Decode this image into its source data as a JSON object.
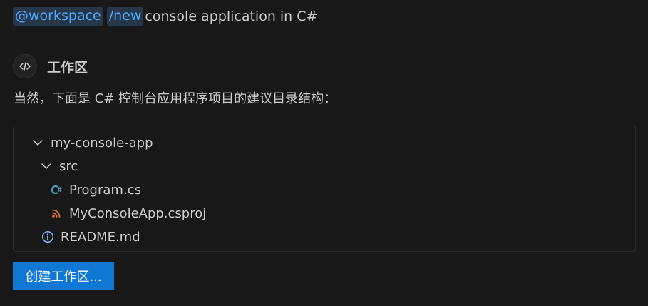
{
  "prompt": {
    "agent_mention": "@workspace",
    "command": "/new",
    "text": "console application in C#"
  },
  "agent": {
    "icon": "code-icon",
    "name": "工作区"
  },
  "response": {
    "text": "当然，下面是 C# 控制台应用程序项目的建议目录结构："
  },
  "file_tree": {
    "items": [
      {
        "label": "my-console-app",
        "type": "folder",
        "expanded": true,
        "icon": "chevron-down-icon"
      },
      {
        "label": "src",
        "type": "folder",
        "expanded": true,
        "icon": "chevron-down-icon"
      },
      {
        "label": "Program.cs",
        "type": "file",
        "icon": "csharp-icon"
      },
      {
        "label": "MyConsoleApp.csproj",
        "type": "file",
        "icon": "rss-icon"
      },
      {
        "label": "README.md",
        "type": "file",
        "icon": "info-icon"
      }
    ]
  },
  "actions": {
    "create_workspace_label": "创建工作区..."
  },
  "colors": {
    "background": "#181818",
    "chip_background": "#26374a",
    "chip_text": "#4daafc",
    "button": "#0e78d4",
    "csharp_icon": "#519aba",
    "csproj_icon": "#e37933",
    "info_icon": "#75beff"
  }
}
